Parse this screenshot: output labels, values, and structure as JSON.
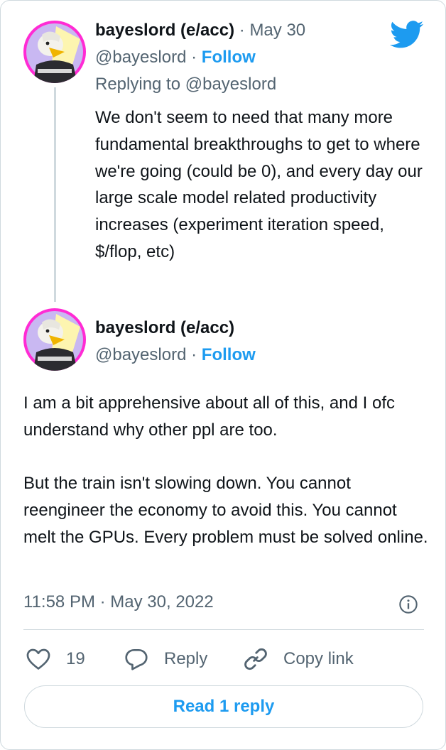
{
  "colors": {
    "accent": "#1d9bf0",
    "muted": "#536471",
    "border": "#cfd9de",
    "avatar_ring": "#ff2bd4"
  },
  "parent_tweet": {
    "name": "bayeslord (e/acc)",
    "date_sep": "·",
    "date": "May 30",
    "handle": "@bayeslord",
    "sep": "·",
    "follow": "Follow",
    "replying_to": "Replying to @bayeslord",
    "text": "We don't seem to need that many more fundamental breakthroughs to get to where we're going (could be 0), and every day our large scale model related productivity increases (experiment iteration speed, $/flop, etc)"
  },
  "main_tweet": {
    "name": "bayeslord (e/acc)",
    "handle": "@bayeslord",
    "sep": "·",
    "follow": "Follow",
    "text": "I am a bit apprehensive about all of this, and I ofc understand why other ppl are too.\n\nBut the train isn't slowing down. You cannot reengineer the economy to avoid this. You cannot melt the GPUs. Every problem must be solved online.",
    "timestamp": "11:58 PM · May 30, 2022"
  },
  "actions": {
    "like_count": "19",
    "reply_label": "Reply",
    "copy_label": "Copy link"
  },
  "read_replies": "Read 1 reply",
  "icons": [
    "twitter-bird-icon",
    "info-icon",
    "heart-icon",
    "reply-bubble-icon",
    "link-icon"
  ]
}
